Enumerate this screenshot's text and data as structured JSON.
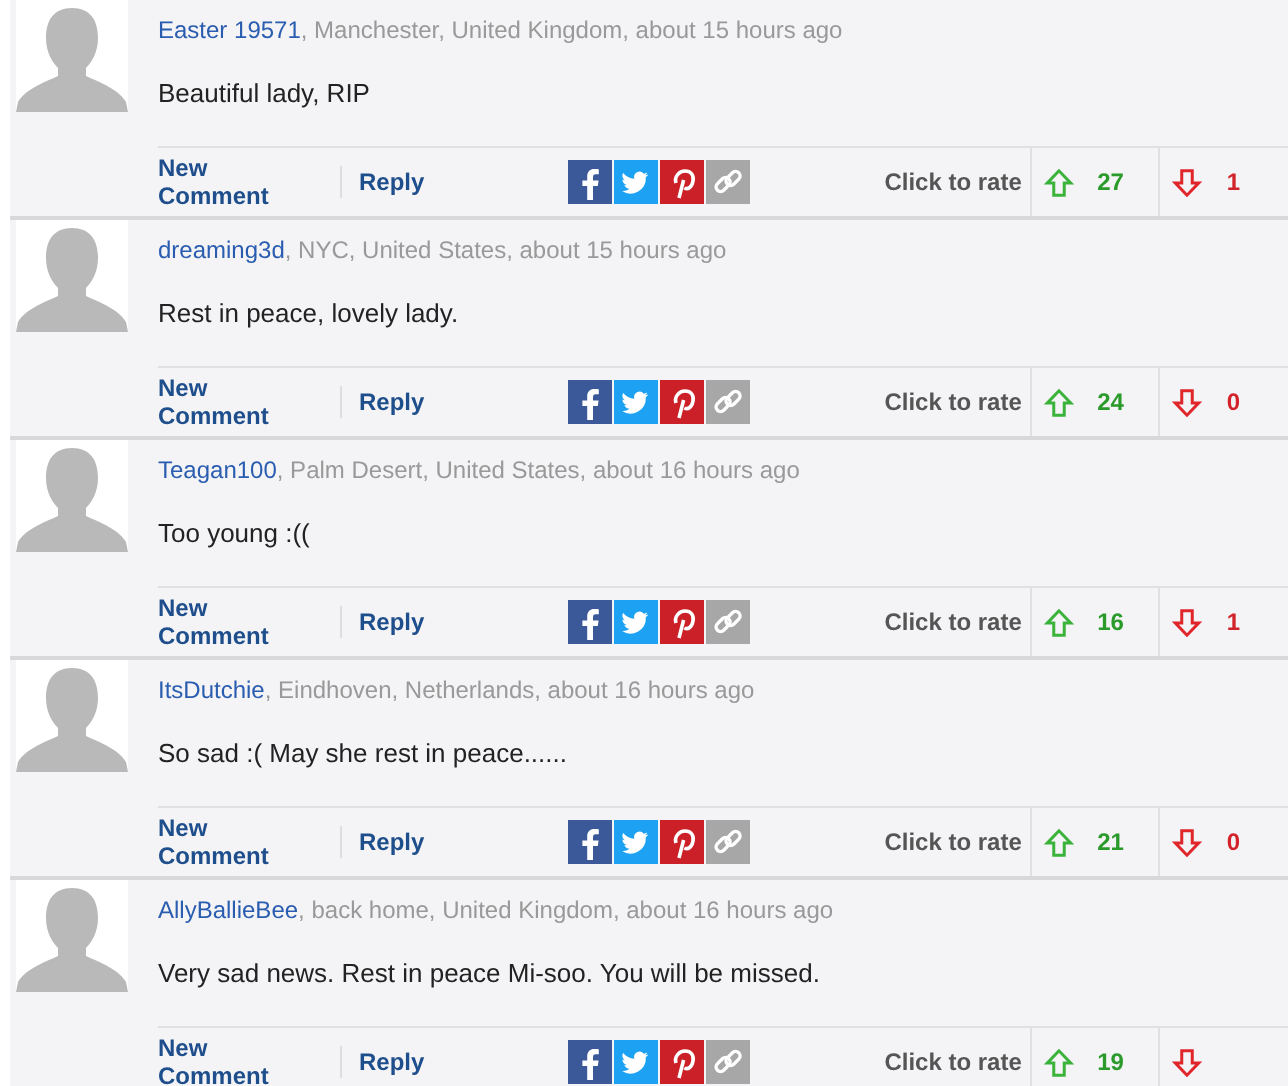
{
  "comments": [
    {
      "author": "Easter 19571",
      "meta": ", Manchester, United Kingdom, about 15 hours ago",
      "body": "Beautiful lady, RIP",
      "new_comment": "New Comment",
      "reply": "Reply",
      "rate_label": "Click to rate",
      "up_count": "27",
      "down_count": "1"
    },
    {
      "author": "dreaming3d",
      "meta": ", NYC, United States, about 15 hours ago",
      "body": "Rest in peace, lovely lady.",
      "new_comment": "New Comment",
      "reply": "Reply",
      "rate_label": "Click to rate",
      "up_count": "24",
      "down_count": "0"
    },
    {
      "author": "Teagan100",
      "meta": ", Palm Desert, United States, about 16 hours ago",
      "body": "Too young :((",
      "new_comment": "New Comment",
      "reply": "Reply",
      "rate_label": "Click to rate",
      "up_count": "16",
      "down_count": "1"
    },
    {
      "author": "ItsDutchie",
      "meta": ", Eindhoven, Netherlands, about 16 hours ago",
      "body": "So sad :( May she rest in peace......",
      "new_comment": "New Comment",
      "reply": "Reply",
      "rate_label": "Click to rate",
      "up_count": "21",
      "down_count": "0"
    },
    {
      "author": "AllyBallieBee",
      "meta": ", back home, United Kingdom, about 16 hours ago",
      "body": "Very sad news. Rest in peace Mi-soo. You will be missed.",
      "new_comment": "New Comment",
      "reply": "Reply",
      "rate_label": "Click to rate",
      "up_count": "19"
    }
  ]
}
